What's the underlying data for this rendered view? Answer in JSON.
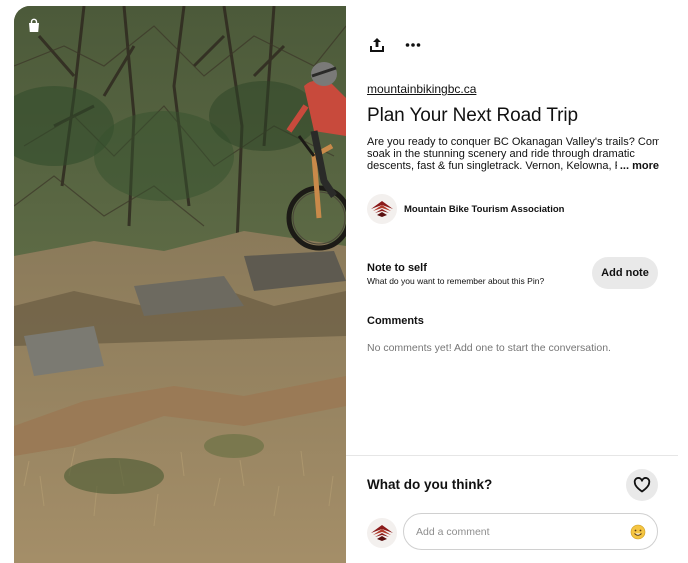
{
  "pin": {
    "source_domain": "mountainbikingbc.ca",
    "title": "Plan Your Next Road Trip",
    "description_lines": [
      "Are you ready to conquer BC Okanagan Valley's trails? Come",
      "soak in the stunning scenery and ride through dramatic",
      "descents, fast & fun singletrack. Vernon, Kelowna, Pe"
    ],
    "more_label": "... more",
    "author_name": "Mountain Bike Tourism Association",
    "image_icon": "shopping-bag-icon"
  },
  "toolbar": {
    "share_icon": "share-icon",
    "more_icon": "ellipsis-icon"
  },
  "note": {
    "title": "Note to self",
    "subtitle": "What do you want to remember about this Pin?",
    "button_label": "Add note"
  },
  "comments": {
    "heading": "Comments",
    "empty_text": "No comments yet! Add one to start the conversation."
  },
  "footer": {
    "prompt": "What do you think?",
    "react_icon": "heart-icon",
    "input_placeholder": "Add a comment",
    "emoji_icon": "smiley-emoji-icon"
  },
  "colors": {
    "button_bg": "#e9e9e9",
    "muted_text": "#767676",
    "logo_red": "#8b1a1a"
  }
}
